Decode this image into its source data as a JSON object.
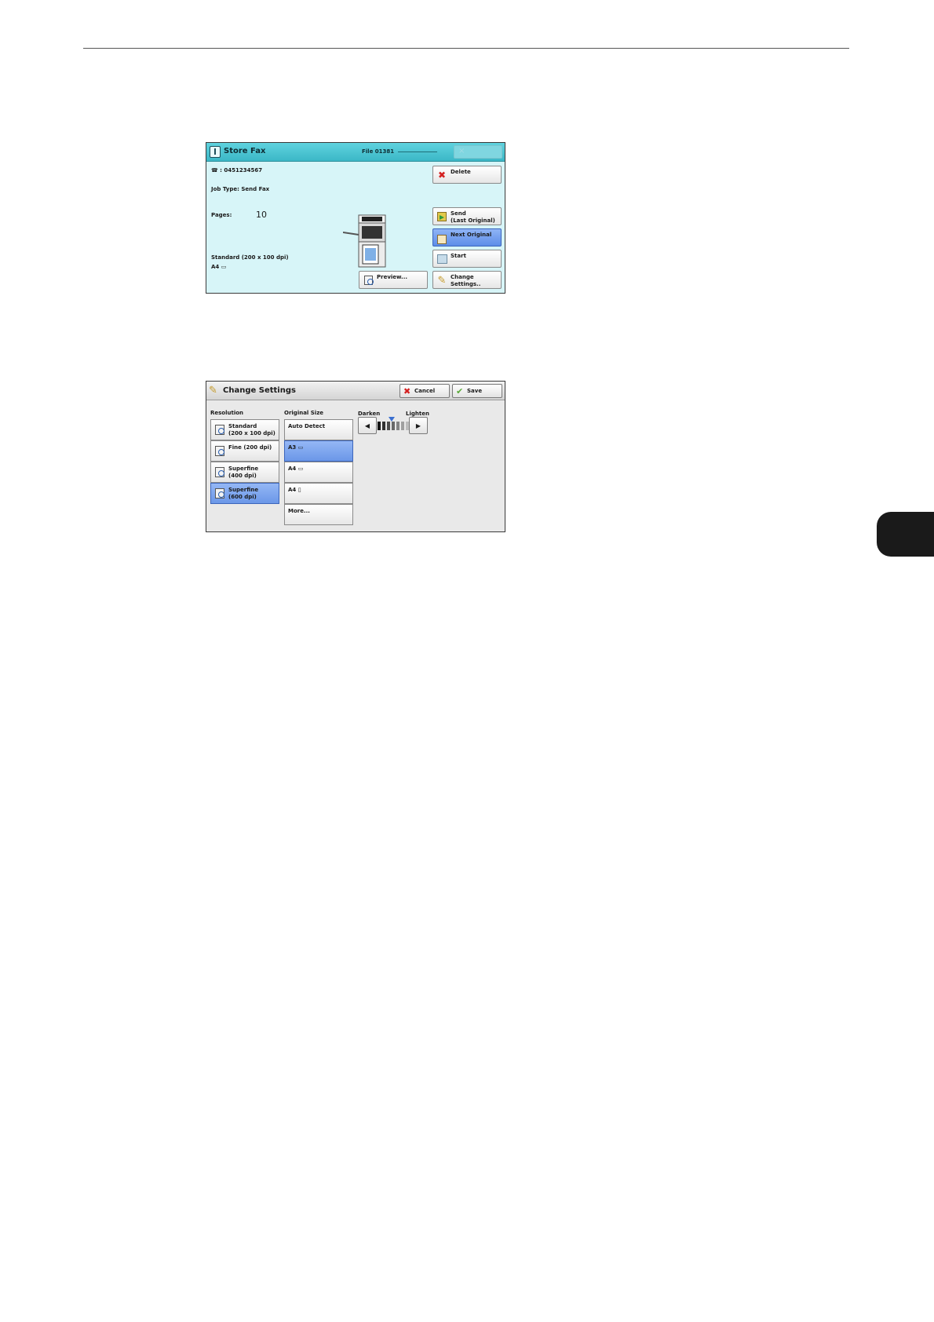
{
  "store_fax": {
    "title": "Store Fax",
    "file": "File 01381",
    "fax_number": "☎ : 0451234567",
    "job_type": "Job Type: Send Fax",
    "pages_label": "Pages:",
    "pages_value": "10",
    "resolution": "Standard (200 x 100 dpi)",
    "paper": "A4 ▭",
    "buttons": {
      "delete": "Delete",
      "send": "Send\n(Last Original)",
      "next_original": "Next Original",
      "start": "Start",
      "change_settings": "Change\nSettings..",
      "preview": "Preview..."
    }
  },
  "change_settings": {
    "title": "Change Settings",
    "cancel": "Cancel",
    "save": "Save",
    "resolution_label": "Resolution",
    "original_size_label": "Original Size",
    "darken_label": "Darken",
    "lighten_label": "Lighten",
    "resolutions": [
      "Standard\n(200 x 100 dpi)",
      "Fine (200 dpi)",
      "Superfine\n(400 dpi)",
      "Superfine\n(600 dpi)"
    ],
    "selected_resolution": "Superfine\n(600 dpi)",
    "sizes": [
      "Auto Detect",
      "A3 ▭",
      "A4 ▭",
      "A4 ▯",
      "More..."
    ],
    "selected_size": "A3 ▭",
    "density_level": 0.45
  },
  "icons": [
    "fax-icon",
    "delete-icon",
    "send-icon",
    "next-original-icon",
    "start-icon",
    "tools-icon",
    "preview-icon",
    "cancel-icon",
    "save-icon",
    "magnifier-icon"
  ]
}
